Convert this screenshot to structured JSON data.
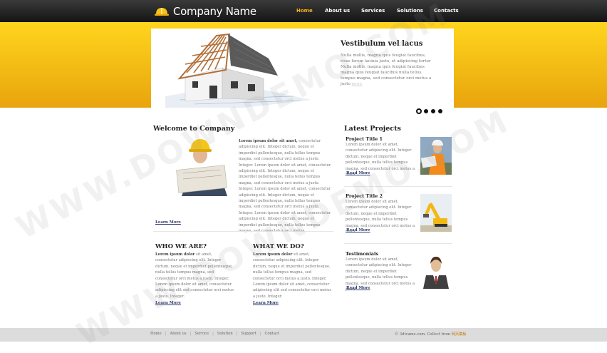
{
  "header": {
    "logo_text": "Company Name",
    "nav": [
      "Home",
      "About us",
      "Services",
      "Solutions",
      "Contacts"
    ],
    "active_nav": "Home"
  },
  "hero": {
    "title": "Vestibulum vel lacus",
    "text": "Nulla mollis, magna quis feugiat faucibus, risus lorem lacinia justo, et adipiscing tortor Nulla mollis. magna quis feugiat faucibus magna quis feugiat faucibus nulla tellus tempus magna, sed consectetur orci metus a justo",
    "more_label": "more"
  },
  "welcome": {
    "title": "Welcome to Company",
    "lead": "Lorem ipsum dolor sit amet,",
    "text": "consectetur adipiscing elit. Integer dictum, neque et imperdiet pellentesque, nulla tellus tempus magna, sed consectetur orci metus a justo. Integer. Lorem ipsum dolor sit amet, consectetur adipiscing elit. Integer dictum, neque et imperdiet pellentesque, nulla tellus tempus magna, sed consectetur orci metus a justo. Integer. Lorem ipsum dolor sit amet, consectetur adipiscing elit. Integer dictum, neque et imperdiet pellentesque, nulla tellus tempus magna, sed consectetur orci metus a justo. Integer. Lorem ipsum dolor sit amet, consectetur adipiscing elit. Integer dictum, neque et imperdiet pellentesque, nulla tellus tempus magna, sed consectetur orci metus.",
    "more_label": "Learn More"
  },
  "who": {
    "title": "WHO WE ARE?",
    "lead": "Lorem ipsum dolor",
    "text": "sit amet, consectetur adipiscing elit. Integer dictum, neque et imperdiet pellentesque, nulla tellus tempus magna, sed consectetur orci metus a justo. Integer. Lorem ipsum dolor sit amet, consectetur adipiscing elit sed consectetur orci metus a justo. Integer.",
    "more_label": "Learn More"
  },
  "what": {
    "title": "WHAT WE DO?",
    "lead": "Lorem ipsum dolor",
    "text": "sit amet, consectetur adipiscing elit. Integer dictum, neque et imperdiet pellentesque, nulla tellus tempus magna, sed consectetur orci metus a justo. Integer. Lorem ipsum dolor sit amet, consectetur adipiscing elit sed consectetur orci metus a justo. Integer.",
    "more_label": "Learn More"
  },
  "projects": {
    "title": "Latest Projects",
    "items": [
      {
        "title": "Project Title 1",
        "text": "Lorem ipsum dolor sit amet, consectetur adipiscing elit. Integer dictum, neque et imperdiet pellentesque, nulla tellus tempus magna, sed consectetur orci metus a justo.",
        "more_label": "Read More"
      },
      {
        "title": "Project Title 2",
        "text": "Lorem ipsum dolor sit amet, consectetur adipiscing elit. Integer dictum, neque et imperdiet pellentesque, nulla tellus tempus magna, sed consectetur orci metus a justo.",
        "more_label": "Read More"
      },
      {
        "title": "Testimonials",
        "text": "Lorem ipsum dolor sit amet, consectetur adipiscing elit. Integer dictum, neque et imperdiet pellentesque, nulla tellus tempus magna, sed consectetur orci metus a justo.",
        "more_label": "Read More"
      }
    ]
  },
  "footer": {
    "links": [
      "Home",
      "About us",
      "Service",
      "Solution",
      "Support",
      "Contact"
    ],
    "copyright": "© 3dtvame.com. Collect from",
    "copyright_link": "网页模板"
  },
  "watermark": [
    "WWW.DOWNDEMO.COM",
    "WWW.DOWNDEMO.COM"
  ],
  "colors": {
    "accent": "#f3b21a",
    "band": "#ffd51d",
    "topbar": "#1e1e1e",
    "link": "#2a3a6a"
  }
}
